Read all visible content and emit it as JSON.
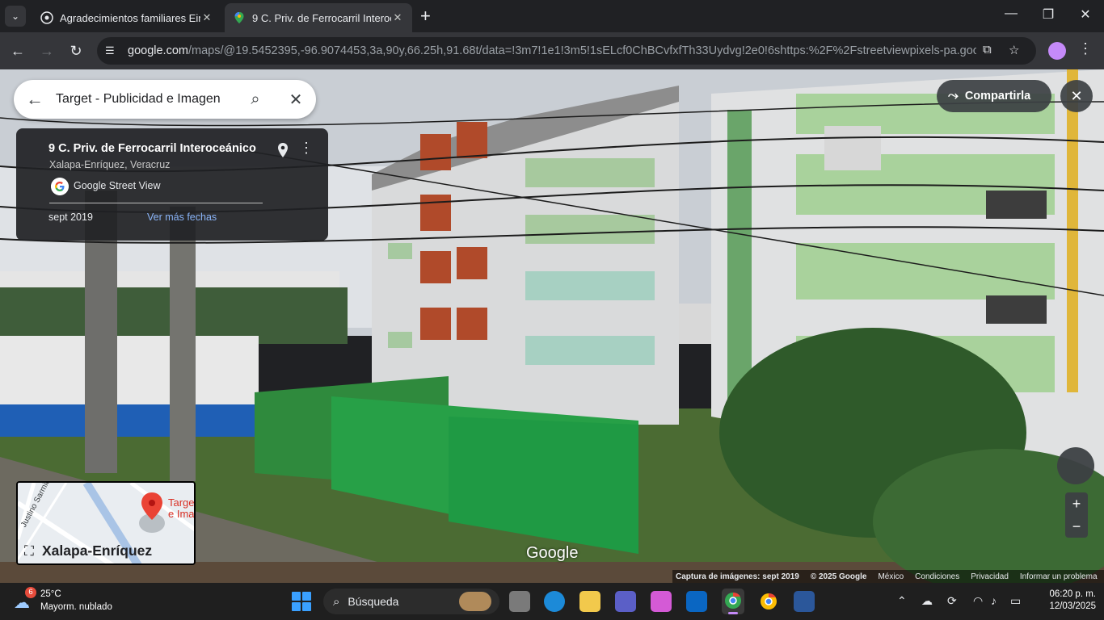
{
  "browser": {
    "tabs": [
      {
        "title": "Agradecimientos familiares Eim",
        "active": false
      },
      {
        "title": "9 C. Priv. de Ferrocarril Interoce",
        "active": true
      }
    ],
    "url_host": "google.com",
    "url_path": "/maps/@19.5452395,-96.9074453,3a,90y,66.25h,91.68t/data=!3m7!1e1!3m5!1sELcf0ChBCvfxfTh33Uydvg!2e0!6shttps:%2F%2Fstreetviewpixels-pa.googleapis...."
  },
  "search": {
    "query": "Target - Publicidad e Imagen"
  },
  "info_card": {
    "address": "9 C. Priv. de Ferrocarril Interoceánico",
    "city": "Xalapa-Enríquez, Veracruz",
    "source": "Google Street View",
    "date": "sept 2019",
    "more_dates": "Ver más fechas"
  },
  "share_label": "Compartirla",
  "minimap": {
    "place_line1": "Targe",
    "place_line2": "e Ima",
    "street": "Justino Sarmie",
    "city": "Xalapa-Enríquez"
  },
  "logo": "Google",
  "attribution": [
    "Captura de imágenes: sept 2019",
    "© 2025 Google",
    "México",
    "Condiciones",
    "Privacidad",
    "Informar un problema"
  ],
  "taskbar": {
    "weather_badge": "6",
    "temperature": "25°C",
    "condition": "Mayorm. nublado",
    "search_placeholder": "Búsqueda",
    "time": "06:20 p. m.",
    "date": "12/03/2025"
  },
  "icons": {
    "tab_search": "chevron-down-icon",
    "new_tab": "plus-icon",
    "back": "arrow-left-icon",
    "forward": "arrow-right-icon",
    "reload": "reload-icon",
    "bookmark": "star-icon",
    "share": "share-icon",
    "close": "close-icon"
  }
}
